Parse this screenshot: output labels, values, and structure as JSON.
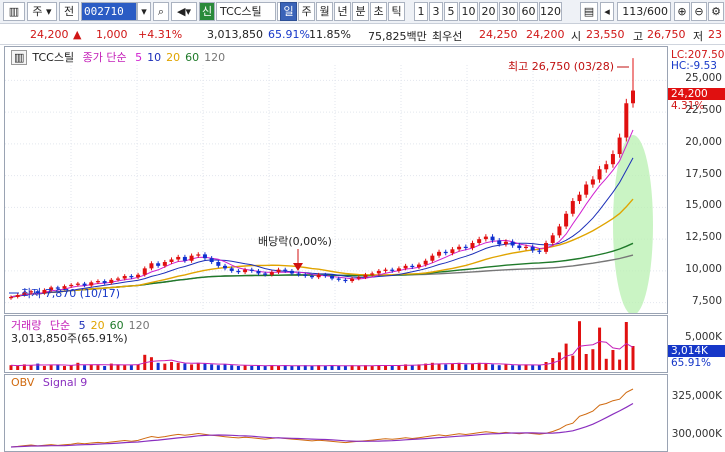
{
  "toolbar": {
    "type_label": "주",
    "prefix_label": "전",
    "stock_code": "002710",
    "credit_badge": "신",
    "stock_name": "TCC스틸",
    "period_tabs": [
      "일",
      "주",
      "월",
      "년",
      "분",
      "초",
      "틱"
    ],
    "interval_tabs": [
      "1",
      "3",
      "5",
      "10",
      "20",
      "30",
      "60",
      "120"
    ],
    "count_value": "113",
    "count_total": "/600"
  },
  "info": {
    "price": "24,200",
    "change_arrow": "▲",
    "change": "1,000",
    "change_pct": "+4.31%",
    "volume": "3,013,850",
    "volume_ratio": "65.91%",
    "turnover": "11.85%",
    "amount": "75,825백만",
    "priority_label": "최우선",
    "ask": "24,250",
    "bid": "24,200",
    "open_label": "시",
    "open": "23,550",
    "high_label": "고",
    "high": "26,750",
    "low_label": "저",
    "low": "23"
  },
  "price_panel": {
    "title": "TCC스틸",
    "ma_label": "종가 단순",
    "ma_periods": [
      "5",
      "10",
      "20",
      "60",
      "120"
    ],
    "ma_colors": [
      "#d01fd0",
      "#1c2fb8",
      "#e0a400",
      "#1f7a2a",
      "#777777"
    ],
    "high_note": "최고 26,750 (03/28)",
    "low_note": "최저 7,870 (10/17)",
    "dividend_note": "배당락(0,00%)",
    "lc_label": "LC:207.50",
    "hc_label": "HC:-9.53",
    "current_price": "24,200",
    "current_pct": "4.31%",
    "y_ticks": [
      "25,000",
      "22,500",
      "20,000",
      "17,500",
      "15,000",
      "12,500",
      "10,000",
      "7,500"
    ]
  },
  "volume_panel": {
    "title": "거래량",
    "ma_label": "단순",
    "ma_periods": [
      "5",
      "20",
      "60",
      "120"
    ],
    "sub_label": "3,013,850주(65.91%)",
    "current": "3,014K",
    "current_pct": "65.91%",
    "y_ticks": [
      "5,000K"
    ]
  },
  "obv_panel": {
    "title": "OBV",
    "signal_label": "Signal 9",
    "y_ticks": [
      "325,000K",
      "300,000K"
    ]
  },
  "colors": {
    "up": "#e01010",
    "down": "#1030d0",
    "highlight": "#b8f0b0"
  },
  "chart_data": {
    "type": "candlestick",
    "title": "TCC스틸",
    "ylim": [
      7000,
      27000
    ],
    "y_ticks": [
      25000,
      22500,
      20000,
      17500,
      15000,
      12500,
      10000,
      7500
    ],
    "closes": [
      7950,
      8100,
      8300,
      8400,
      8250,
      8500,
      8700,
      8600,
      8800,
      8900,
      9000,
      8850,
      9100,
      9200,
      9050,
      9300,
      9400,
      9600,
      9500,
      9700,
      10200,
      10600,
      10400,
      10700,
      10900,
      11100,
      10800,
      11200,
      11300,
      11000,
      10700,
      10400,
      10200,
      10000,
      9900,
      10100,
      10000,
      9800,
      9700,
      9900,
      10100,
      10000,
      9800,
      9700,
      9600,
      9500,
      9700,
      9600,
      9400,
      9300,
      9200,
      9400,
      9500,
      9700,
      9800,
      10000,
      10100,
      10000,
      10200,
      10400,
      10300,
      10500,
      10800,
      11200,
      11500,
      11400,
      11700,
      11900,
      11800,
      12200,
      12500,
      12700,
      12400,
      12100,
      12300,
      12000,
      11800,
      11900,
      11600,
      11500,
      12200,
      12800,
      13500,
      14500,
      15500,
      16000,
      16800,
      17200,
      18000,
      18400,
      19200,
      20500,
      23200,
      24200
    ],
    "highs_marked": {
      "value": 26750,
      "date": "03/28"
    },
    "lows_marked": {
      "value": 7870,
      "date": "10/17"
    },
    "volume": [
      0.6,
      0.5,
      0.7,
      0.6,
      0.8,
      0.5,
      0.6,
      0.7,
      0.5,
      0.6,
      0.9,
      0.6,
      0.7,
      0.6,
      0.5,
      0.8,
      0.7,
      0.6,
      0.6,
      0.7,
      1.9,
      1.6,
      0.9,
      0.8,
      1.0,
      0.9,
      0.8,
      0.7,
      0.9,
      0.8,
      0.7,
      0.6,
      0.7,
      0.6,
      0.5,
      0.6,
      0.5,
      0.6,
      0.5,
      0.6,
      0.5,
      0.6,
      0.5,
      0.5,
      0.6,
      0.5,
      0.6,
      0.5,
      0.6,
      0.5,
      0.5,
      0.6,
      0.5,
      0.6,
      0.5,
      0.6,
      0.6,
      0.5,
      0.6,
      0.7,
      0.6,
      0.7,
      0.8,
      0.9,
      0.8,
      0.7,
      0.8,
      0.9,
      0.7,
      0.8,
      0.9,
      0.8,
      0.7,
      0.6,
      0.7,
      0.6,
      0.6,
      0.7,
      0.6,
      0.6,
      1.0,
      1.5,
      2.2,
      3.3,
      1.8,
      6.1,
      2.0,
      2.6,
      5.3,
      1.4,
      2.5,
      1.3,
      6.0,
      3.0
    ]
  }
}
